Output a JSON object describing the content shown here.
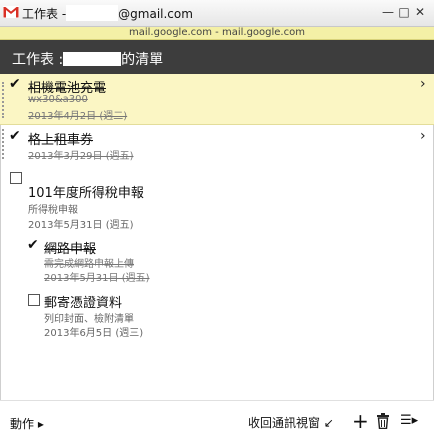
{
  "window": {
    "title_prefix": "工作表 -",
    "title_suffix": "@gmail.com",
    "minimize": "—",
    "maximize": "□",
    "close": "✕"
  },
  "domain_bar": "mail.google.com - mail.google.com",
  "header": {
    "prefix": "工作表 :",
    "suffix": "的清單"
  },
  "tasks": [
    {
      "title": "相機電池充電",
      "note": "wx30&a300",
      "date": "2013年4月2日 (週二)",
      "done": true
    },
    {
      "title": "格上租車券",
      "date": "2013年3月29日 (週五)",
      "done": true
    },
    {
      "title": "101年度所得稅申報",
      "note": "所得稅申報",
      "date": "2013年5月31日 (週五)",
      "done": false,
      "subtasks": [
        {
          "title": "網路申報",
          "note": "需完成網路申報上傳",
          "date": "2013年5月31日 (週五)",
          "done": true
        },
        {
          "title": "郵寄憑證資料",
          "note": "列印封面、檢附清單",
          "date": "2013年6月5日 (週三)",
          "done": false
        }
      ]
    }
  ],
  "footer": {
    "actions": "動作 ▸",
    "collapse": "收回通訊視窗 ↙",
    "add": "+",
    "list_menu": "☰▸"
  },
  "icons": [
    "gmail-logo-icon",
    "checkmark-icon",
    "checkbox-icon",
    "chevron-right-icon",
    "trash-icon",
    "list-icon",
    "plus-icon"
  ],
  "colors": {
    "header_bg": "#3d3d3d",
    "selected_bg": "#fbf6c4",
    "domain_bar_bg": "#f4f0a6",
    "gmail_red": "#d93025"
  }
}
